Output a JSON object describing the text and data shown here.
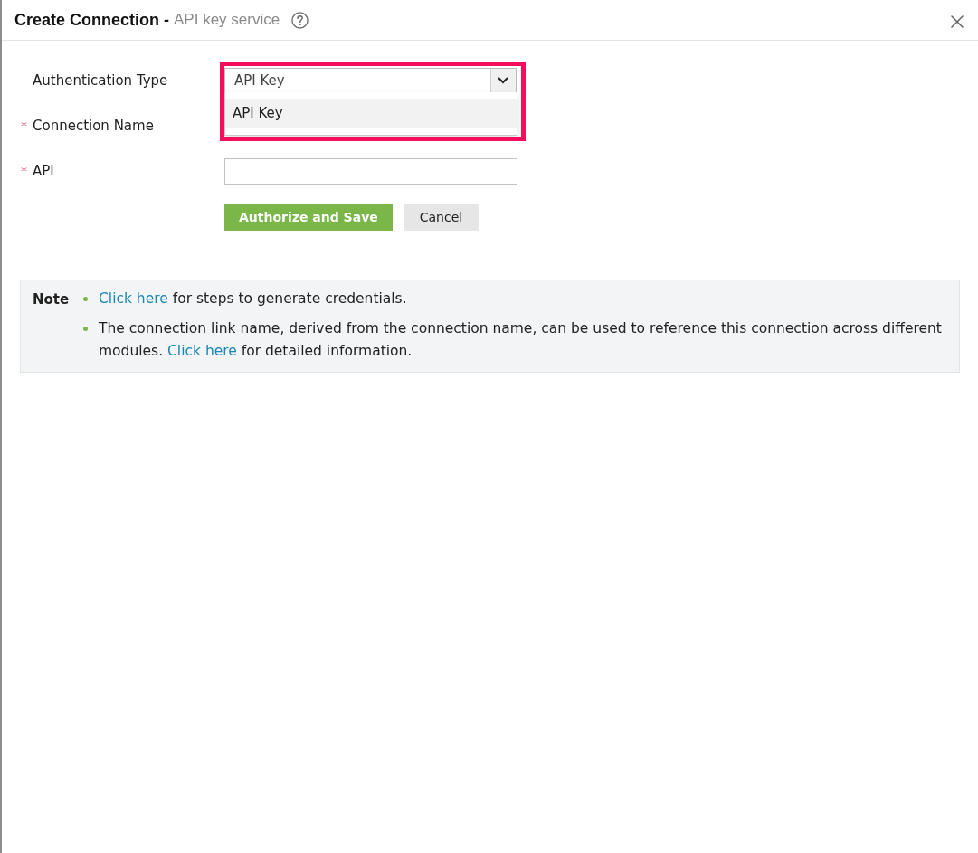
{
  "dialog": {
    "title": "Create Connection -",
    "subtitle": "API key service"
  },
  "fields": [
    {
      "kind": "select",
      "label": "Authentication Type",
      "value": "API Key",
      "highlighted": true,
      "dropdown": {
        "open": true,
        "options": [
          {
            "label": "API Key",
            "selected": true
          }
        ]
      }
    },
    {
      "kind": "label",
      "label": "Connection Name",
      "required_mark": "*"
    },
    {
      "kind": "text",
      "label": "API",
      "required_mark": "*"
    }
  ],
  "buttons": [
    {
      "kind": "primary",
      "label": "Authorize and Save"
    },
    {
      "kind": "secondary",
      "label": "Cancel"
    }
  ],
  "note": {
    "title": "Note",
    "items": [
      {
        "parts": [
          {
            "kind": "link",
            "text": "Click here"
          },
          {
            "kind": "text",
            "text": " for steps to generate credentials."
          }
        ]
      },
      {
        "parts": [
          {
            "kind": "text",
            "text": "The connection link name, derived from the connection name, can be used to reference this connection across different modules. "
          },
          {
            "kind": "link",
            "text": "Click here"
          },
          {
            "kind": "text",
            "text": " for detailed information."
          }
        ]
      }
    ]
  }
}
